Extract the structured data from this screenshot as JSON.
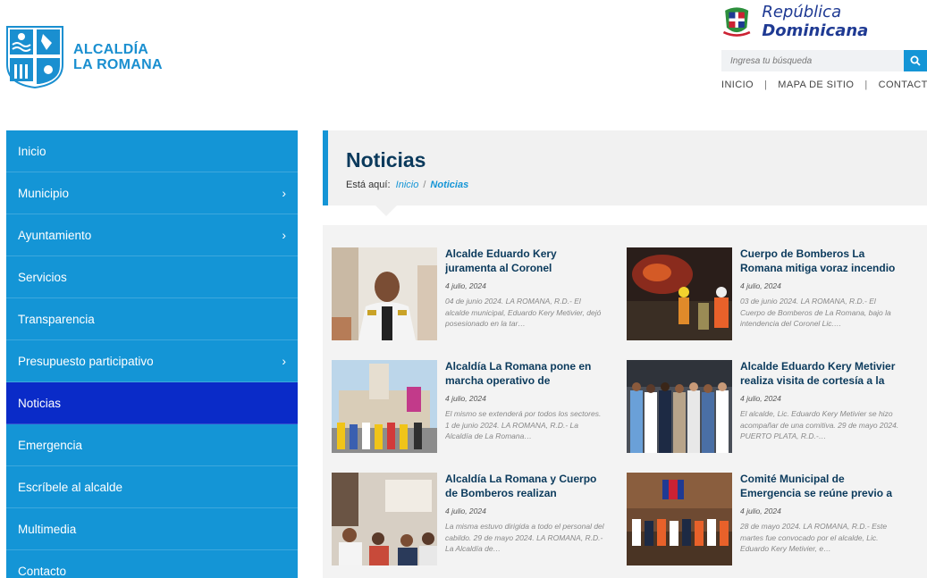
{
  "header": {
    "logo_line1": "ALCALDÍA",
    "logo_line2": "LA ROMANA",
    "country_regular": "República ",
    "country_bold": "Dominicana",
    "search_placeholder": "Ingresa tu búsqueda",
    "links": [
      "INICIO",
      "MAPA DE SITIO",
      "CONTACTO"
    ]
  },
  "sidebar": {
    "items": [
      {
        "label": "Inicio",
        "has_submenu": false
      },
      {
        "label": "Municipio",
        "has_submenu": true
      },
      {
        "label": "Ayuntamiento",
        "has_submenu": true
      },
      {
        "label": "Servicios",
        "has_submenu": false
      },
      {
        "label": "Transparencia",
        "has_submenu": false
      },
      {
        "label": "Presupuesto participativo",
        "has_submenu": true
      },
      {
        "label": "Noticias",
        "has_submenu": false,
        "active": true
      },
      {
        "label": "Emergencia",
        "has_submenu": false
      },
      {
        "label": "Escríbele al alcalde",
        "has_submenu": false
      },
      {
        "label": "Multimedia",
        "has_submenu": false
      },
      {
        "label": "Contacto",
        "has_submenu": false
      }
    ]
  },
  "page": {
    "title": "Noticias",
    "breadcrumb_prefix": "Está aquí:",
    "breadcrumb_home": "Inicio",
    "breadcrumb_current": "Noticias"
  },
  "news": [
    {
      "title": "Alcalde Eduardo Kery juramenta al Coronel",
      "date": "4 julio, 2024",
      "excerpt": "04 de junio 2024. LA ROMANA, R.D.- El alcalde municipal, Eduardo Kery Metivier, dejó posesionado en la tar…"
    },
    {
      "title": "Cuerpo de Bomberos La Romana mitiga voraz incendio",
      "date": "4 julio, 2024",
      "excerpt": "03 de junio 2024. LA ROMANA, R.D.- El Cuerpo de Bomberos de La Romana, bajo la intendencia del Coronel Lic.…"
    },
    {
      "title": "Alcaldía La Romana pone en marcha operativo de",
      "date": "4 julio, 2024",
      "excerpt": "El mismo se extenderá por todos los sectores. 1 de junio 2024. LA ROMANA, R.D.- La Alcaldía de La Romana…"
    },
    {
      "title": "Alcalde Eduardo Kery Metivier realiza visita de cortesía a la",
      "date": "4 julio, 2024",
      "excerpt": "El alcalde, Lic. Eduardo Kery Metivier se hizo acompañar de una comitiva. 29 de mayo 2024. PUERTO PLATA, R.D.-…"
    },
    {
      "title": "Alcaldía La Romana y Cuerpo de Bomberos realizan",
      "date": "4 julio, 2024",
      "excerpt": "La misma estuvo dirigida a todo el personal del cabildo. 29 de mayo 2024. LA ROMANA, R.D.- La Alcaldía de…"
    },
    {
      "title": "Comité Municipal de Emergencia se reúne previo a",
      "date": "4 julio, 2024",
      "excerpt": "28 de mayo 2024. LA ROMANA, R.D.- Este martes fue convocado por el alcalde, Lic. Eduardo Kery Metivier, e…"
    }
  ],
  "colors": {
    "primary": "#1495d6",
    "active": "#0a2bc8",
    "title": "#0b3a5c"
  }
}
